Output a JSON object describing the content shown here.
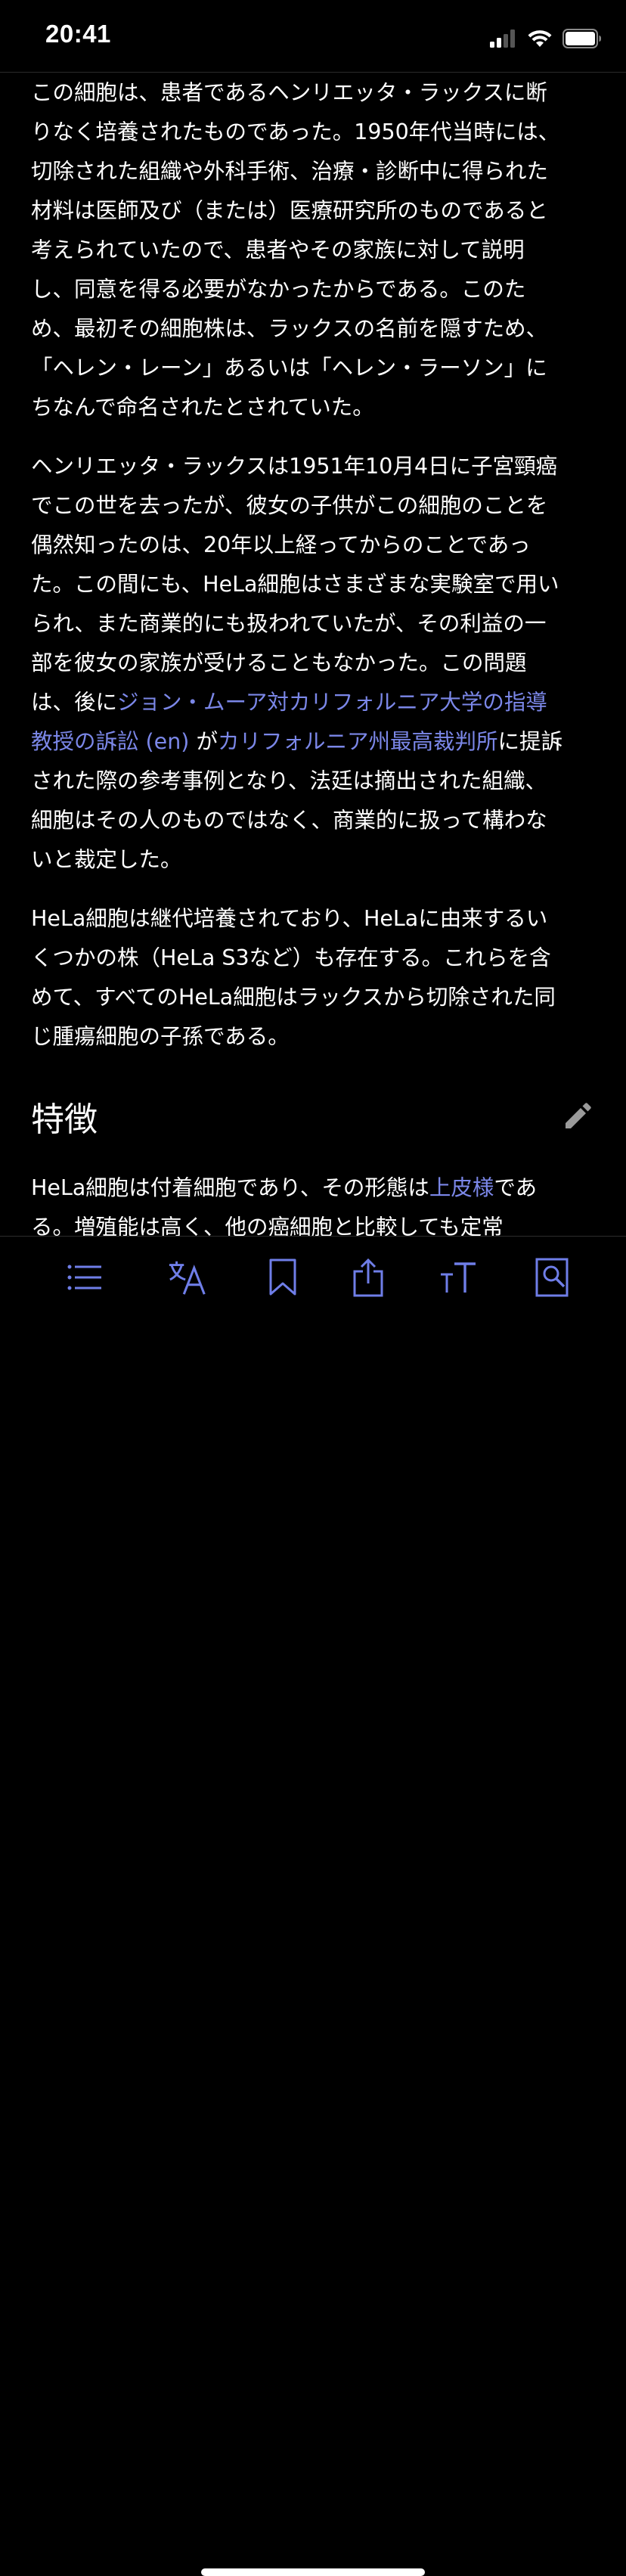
{
  "status_bar": {
    "time": "20:41",
    "icons": [
      "cellular-signal-icon",
      "wifi-icon",
      "battery-icon"
    ]
  },
  "article": {
    "paragraphs": [
      {
        "segments": [
          {
            "text": "この細胞は、患者であるヘンリエッタ・ラックスに断\nりなく培養されたものであった。1950年代当時には、\n切除された組織や外科手術、治療・診断中に得られた\n材料は医師及び（または）医療研究所のものであると\n考えられていたので、患者やその家族に対して説明\nし、同意を得る必要がなかったからである。このた\nめ、最初その細胞株は、ラックスの名前を隠すため、\n「ヘレン・レーン」あるいは「ヘレン・ラーソン」に\nちなんで命名されたとされていた。",
            "link": false
          }
        ]
      },
      {
        "segments": [
          {
            "text": "ヘンリエッタ・ラックスは1951年10月4日に子宮頸癌\nでこの世を去ったが、彼女の子供がこの細胞のことを\n偶然知ったのは、20年以上経ってからのことであっ\nた。この間にも、HeLa細胞はさまざまな実験室で用い\nられ、また商業的にも扱われていたが、その利益の一\n部を彼女の家族が受けることもなかった。この問題\nは、後に",
            "link": false
          },
          {
            "text": "ジョン・ムーア対カリフォルニア大学の指導\n教授の訴訟 (en)",
            "link": true
          },
          {
            "text": " が",
            "link": false
          },
          {
            "text": "カリフォルニア州最高裁判所",
            "link": true
          },
          {
            "text": "に提訴\nされた際の参考事例となり、法廷は摘出された組織、\n細胞はその人のものではなく、商業的に扱って構わな\nいと裁定した。",
            "link": false
          }
        ]
      },
      {
        "segments": [
          {
            "text": "HeLa細胞は継代培養されており、HeLaに由来するい\nくつかの株（HeLa S3など）も存在する。これらを含\nめて、すべてのHeLa細胞はラックスから切除された同\nじ腫瘍細胞の子孫である。",
            "link": false
          }
        ]
      }
    ],
    "section_title": "特徴",
    "section_edit_icon": "pencil-icon",
    "section_paragraph": {
      "segments": [
        {
          "text": "HeLa細胞は付着細胞であり、その形態は",
          "link": false
        },
        {
          "text": "上皮様",
          "link": true
        },
        {
          "text": "であ\nる。増殖能は高く、他の癌細胞と比較しても定常",
          "link": false
        }
      ]
    }
  },
  "toolbar": {
    "buttons": [
      {
        "name": "table-of-contents",
        "icon": "list-icon"
      },
      {
        "name": "language",
        "icon": "translate-icon"
      },
      {
        "name": "save",
        "icon": "bookmark-icon"
      },
      {
        "name": "share",
        "icon": "share-icon"
      },
      {
        "name": "text-size",
        "icon": "text-size-icon"
      },
      {
        "name": "find-in-page",
        "icon": "find-in-page-icon"
      }
    ]
  },
  "colors": {
    "background": "#000000",
    "text": "#ffffff",
    "link": "#7b87e8",
    "toolbar_icon": "#6f7ee8"
  }
}
